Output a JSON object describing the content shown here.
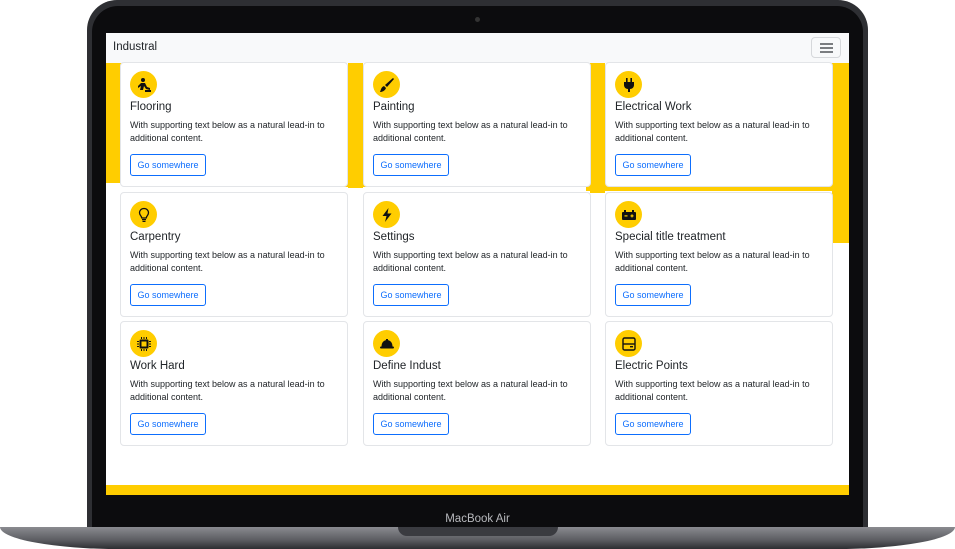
{
  "device": {
    "label": "MacBook Air"
  },
  "navbar": {
    "brand": "Industral",
    "toggler_icon": "hamburger-icon"
  },
  "colors": {
    "accent": "#ffcd00",
    "button": "#0d6efd",
    "frame": "#2e2f33"
  },
  "cards": [
    {
      "icon": "worker-icon",
      "title": "Flooring",
      "text": "With supporting text below as a natural lead-in to additional content.",
      "button": "Go somewhere"
    },
    {
      "icon": "paintbrush-icon",
      "title": "Painting",
      "text": "With supporting text below as a natural lead-in to additional content.",
      "button": "Go somewhere"
    },
    {
      "icon": "plug-icon",
      "title": "Electrical Work",
      "text": "With supporting text below as a natural lead-in to additional content.",
      "button": "Go somewhere"
    },
    {
      "icon": "lightbulb-icon",
      "title": "Carpentry",
      "text": "With supporting text below as a natural lead-in to additional content.",
      "button": "Go somewhere"
    },
    {
      "icon": "lightning-icon",
      "title": "Settings",
      "text": "With supporting text below as a natural lead-in to additional content.",
      "button": "Go somewhere"
    },
    {
      "icon": "battery-icon",
      "title": "Special title treatment",
      "text": "With supporting text below as a natural lead-in to additional content.",
      "button": "Go somewhere"
    },
    {
      "icon": "cpu-icon",
      "title": "Work Hard",
      "text": "With supporting text below as a natural lead-in to additional content.",
      "button": "Go somewhere"
    },
    {
      "icon": "hard-hat-icon",
      "title": "Define Indust",
      "text": "With supporting text below as a natural lead-in to additional content.",
      "button": "Go somewhere"
    },
    {
      "icon": "electric-panel-icon",
      "title": "Electric Points",
      "text": "With supporting text below as a natural lead-in to additional content.",
      "button": "Go somewhere"
    }
  ]
}
